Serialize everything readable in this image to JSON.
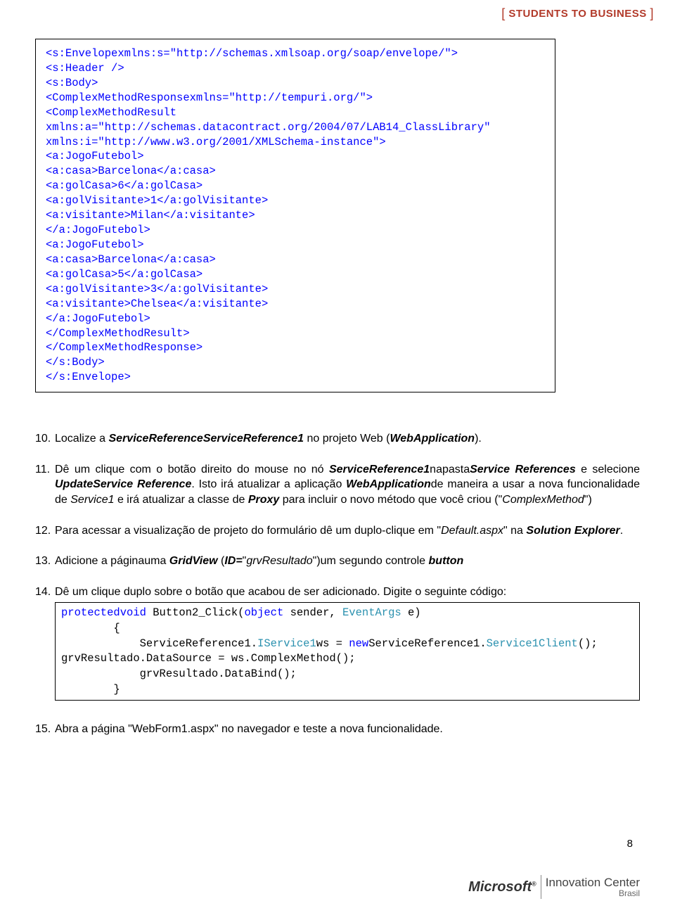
{
  "header": {
    "tag_left_bracket": "[",
    "tag_text": "STUDENTS TO BUSINESS",
    "tag_right_bracket": "]"
  },
  "code_block": "<s:Envelopexmlns:s=\"http://schemas.xmlsoap.org/soap/envelope/\">\n<s:Header />\n<s:Body>\n<ComplexMethodResponsexmlns=\"http://tempuri.org/\">\n<ComplexMethodResult\nxmlns:a=\"http://schemas.datacontract.org/2004/07/LAB14_ClassLibrary\"\nxmlns:i=\"http://www.w3.org/2001/XMLSchema-instance\">\n<a:JogoFutebol>\n<a:casa>Barcelona</a:casa>\n<a:golCasa>6</a:golCasa>\n<a:golVisitante>1</a:golVisitante>\n<a:visitante>Milan</a:visitante>\n</a:JogoFutebol>\n<a:JogoFutebol>\n<a:casa>Barcelona</a:casa>\n<a:golCasa>5</a:golCasa>\n<a:golVisitante>3</a:golVisitante>\n<a:visitante>Chelsea</a:visitante>\n</a:JogoFutebol>\n</ComplexMethodResult>\n</ComplexMethodResponse>\n</s:Body>\n</s:Envelope>",
  "items": {
    "n10": "10.",
    "t10_a": "Localize a ",
    "t10_b": "ServiceReferenceServiceReference1",
    "t10_c": " no projeto Web (",
    "t10_d": "WebApplication",
    "t10_e": ").",
    "n11": "11.",
    "t11_a": "Dê um clique com o botão direito do mouse no nó ",
    "t11_b": "ServiceReference1",
    "t11_c": "napasta",
    "t11_d": "Service References",
    "t11_e": " e selecione ",
    "t11_f": "UpdateService Reference",
    "t11_g": ". Isto irá atualizar a aplicação ",
    "t11_h": "WebApplication",
    "t11_i": "de maneira a usar a nova funcionalidade de ",
    "t11_j": "Service1",
    "t11_k": " e irá atualizar a classe de ",
    "t11_l": "Proxy",
    "t11_m": " para incluir o novo método que você criou (\"",
    "t11_n": "ComplexMethod",
    "t11_o": "\")",
    "n12": "12.",
    "t12_a": "Para acessar a visualização de projeto do formulário dê um duplo-clique em \"",
    "t12_b": "Default.aspx",
    "t12_c": "\" na ",
    "t12_d": "Solution Explorer",
    "t12_e": ".",
    "n13": "13.",
    "t13_a": "Adicione a páginauma ",
    "t13_b": "GridView",
    "t13_c": " (",
    "t13_d": "ID=",
    "t13_e": "\"",
    "t13_f": "grvResultado",
    "t13_g": "\")um segundo controle ",
    "t13_h": "button",
    "n14": "14.",
    "t14": "Dê um clique duplo sobre o botão que acabou de ser adicionado. Digite o seguinte código:",
    "n15": "15.",
    "t15": "Abra a página \"WebForm1.aspx\" no navegador e teste a nova funcionalidade."
  },
  "code2": {
    "l1_a": "protectedvoid",
    "l1_b": " Button2_Click(",
    "l1_c": "object",
    "l1_d": " sender, ",
    "l1_e": "EventArgs",
    "l1_f": " e)",
    "l2": "        {",
    "l3_a": "            ServiceReference1.",
    "l3_b": "IService1",
    "l3_c": "ws = ",
    "l3_d": "new",
    "l3_e": "ServiceReference1.",
    "l3_f": "Service1Client",
    "l3_g": "();",
    "l4": "grvResultado.DataSource = ws.ComplexMethod();",
    "l5": "            grvResultado.DataBind();",
    "l6": "        }"
  },
  "page_number": "8",
  "footer": {
    "ms": "Microsoft",
    "reg": "®",
    "ic1": "Innovation Center",
    "ic2": "Brasil"
  }
}
